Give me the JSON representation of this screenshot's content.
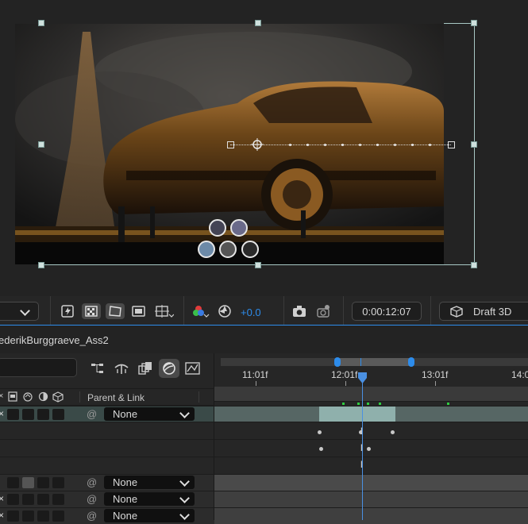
{
  "toolbar": {
    "exposure_value": "+0.0",
    "timecode": "0:00:12:07",
    "renderer_label": "Draft 3D",
    "icons": [
      "fast-preview-icon",
      "transparency-grid-icon",
      "region-of-interest-icon",
      "mask-visibility-icon",
      "guides-icon",
      "channel-color-icon",
      "reset-exposure-icon",
      "snapshot-icon",
      "show-snapshot-icon",
      "3d-renderer-icon"
    ]
  },
  "composition": {
    "name": "ederikBurggraeve_Ass2"
  },
  "layer_panel": {
    "parent_header": "Parent & Link",
    "rows": [
      {
        "parent": "None"
      },
      {
        "parent": "None"
      },
      {
        "parent": "None"
      },
      {
        "parent": "None"
      }
    ]
  },
  "timeline": {
    "ruler_labels": [
      "11:01f",
      "12:01f",
      "13:01f",
      "14:0"
    ]
  },
  "colors": {
    "accent_blue": "#2d8ceb",
    "playhead": "#4a90e2",
    "keyframe_green": "#2ecc40"
  }
}
